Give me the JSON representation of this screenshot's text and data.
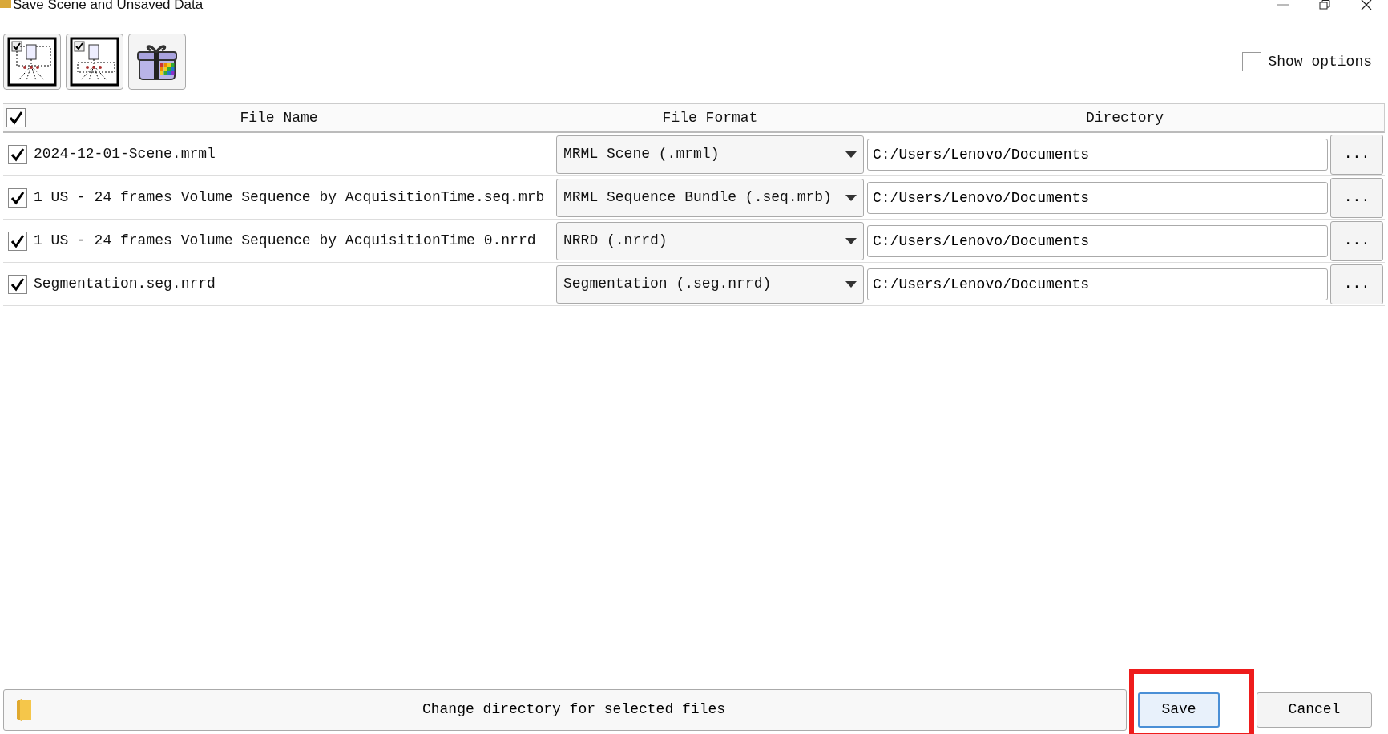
{
  "window": {
    "title": "Save Scene and Unsaved Data"
  },
  "show_options": {
    "label": "Show options",
    "checked": false
  },
  "table": {
    "all_checked": true,
    "columns": [
      "File Name",
      "File Format",
      "Directory"
    ],
    "rows": [
      {
        "checked": true,
        "file_name": "2024-12-01-Scene.mrml",
        "format": "MRML Scene (.mrml)",
        "directory": "C:/Users/Lenovo/Documents",
        "browse": "..."
      },
      {
        "checked": true,
        "file_name": "1 US - 24 frames Volume Sequence by AcquisitionTime.seq.mrb",
        "format": "MRML Sequence Bundle (.seq.mrb)",
        "directory": "C:/Users/Lenovo/Documents",
        "browse": "..."
      },
      {
        "checked": true,
        "file_name": "1 US - 24 frames Volume Sequence by AcquisitionTime 0.nrrd",
        "format": "NRRD (.nrrd)",
        "directory": "C:/Users/Lenovo/Documents",
        "browse": "..."
      },
      {
        "checked": true,
        "file_name": "Segmentation.seg.nrrd",
        "format": "Segmentation (.seg.nrrd)",
        "directory": "C:/Users/Lenovo/Documents",
        "browse": "..."
      }
    ]
  },
  "change_directory_button": "Change directory for selected files",
  "buttons": [
    "Save",
    "Cancel"
  ]
}
